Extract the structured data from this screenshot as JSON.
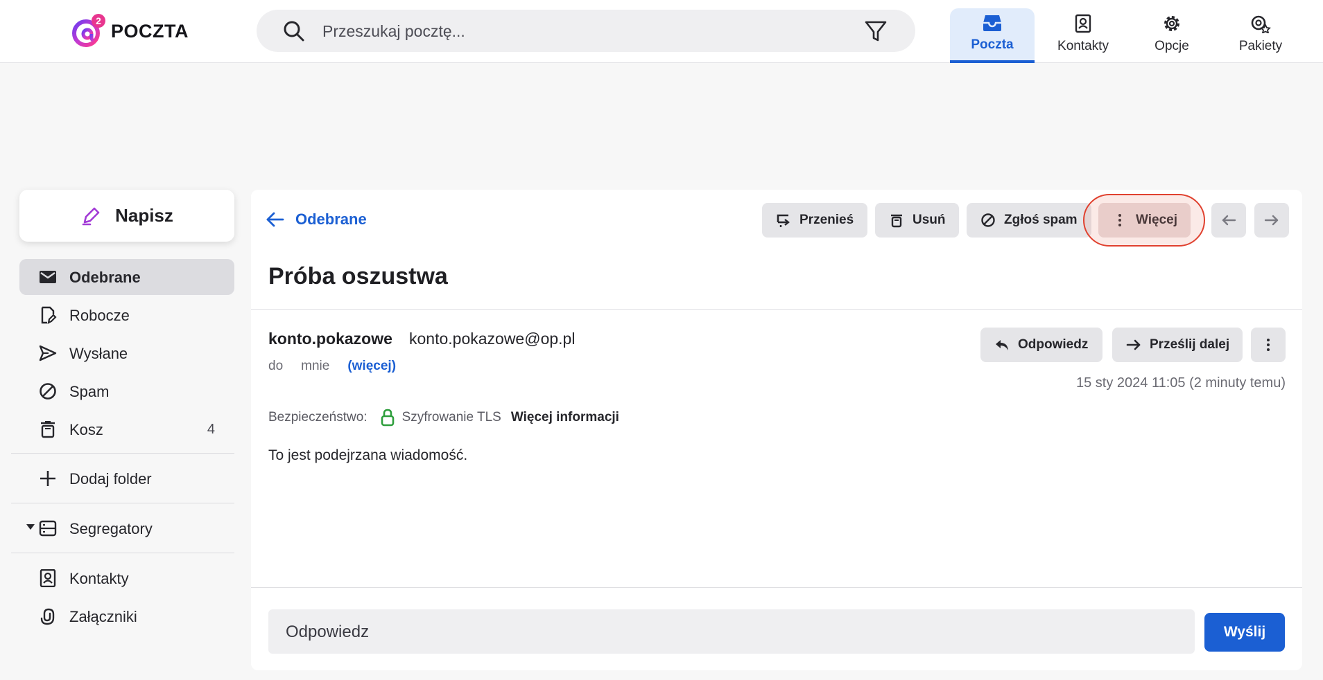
{
  "brand": {
    "name": "POCZTA",
    "superscript": "2"
  },
  "search": {
    "placeholder": "Przeszukaj pocztę..."
  },
  "nav": {
    "items": [
      {
        "label": "Poczta",
        "icon": "inbox-icon",
        "active": true
      },
      {
        "label": "Kontakty",
        "icon": "contacts-icon"
      },
      {
        "label": "Opcje",
        "icon": "gear-icon"
      },
      {
        "label": "Pakiety",
        "icon": "packages-icon"
      }
    ]
  },
  "sidebar": {
    "compose_label": "Napisz",
    "items": [
      {
        "label": "Odebrane",
        "icon": "inbox-mail-icon",
        "active": true
      },
      {
        "label": "Robocze",
        "icon": "drafts-icon"
      },
      {
        "label": "Wysłane",
        "icon": "send-icon"
      },
      {
        "label": "Spam",
        "icon": "spam-icon"
      },
      {
        "label": "Kosz",
        "icon": "trash-icon",
        "count": "4"
      }
    ],
    "add_folder": "Dodaj folder",
    "binders": "Segregatory",
    "contacts": "Kontakty",
    "attachments": "Załączniki"
  },
  "toolbar": {
    "back_label": "Odebrane",
    "move": "Przenieś",
    "delete": "Usuń",
    "report_spam": "Zgłoś spam",
    "more": "Więcej"
  },
  "message": {
    "subject": "Próba oszustwa",
    "sender_name": "konto.pokazowe",
    "sender_email": "konto.pokazowe@op.pl",
    "to_prefix": "do",
    "to": "mnie",
    "more_link": "(więcej)",
    "reply": "Odpowiedz",
    "forward": "Prześlij dalej",
    "date": "15 sty 2024 11:05 (2 minuty temu)",
    "security_label": "Bezpieczeństwo:",
    "security_value": "Szyfrowanie TLS",
    "security_more": "Więcej informacji",
    "body": "To jest podejrzana wiadomość."
  },
  "quick_reply": {
    "placeholder": "Odpowiedz",
    "send": "Wyślij"
  },
  "colors": {
    "accent": "#1b5fd3",
    "highlight": "#e0412f",
    "secure": "#2e9e3c"
  }
}
